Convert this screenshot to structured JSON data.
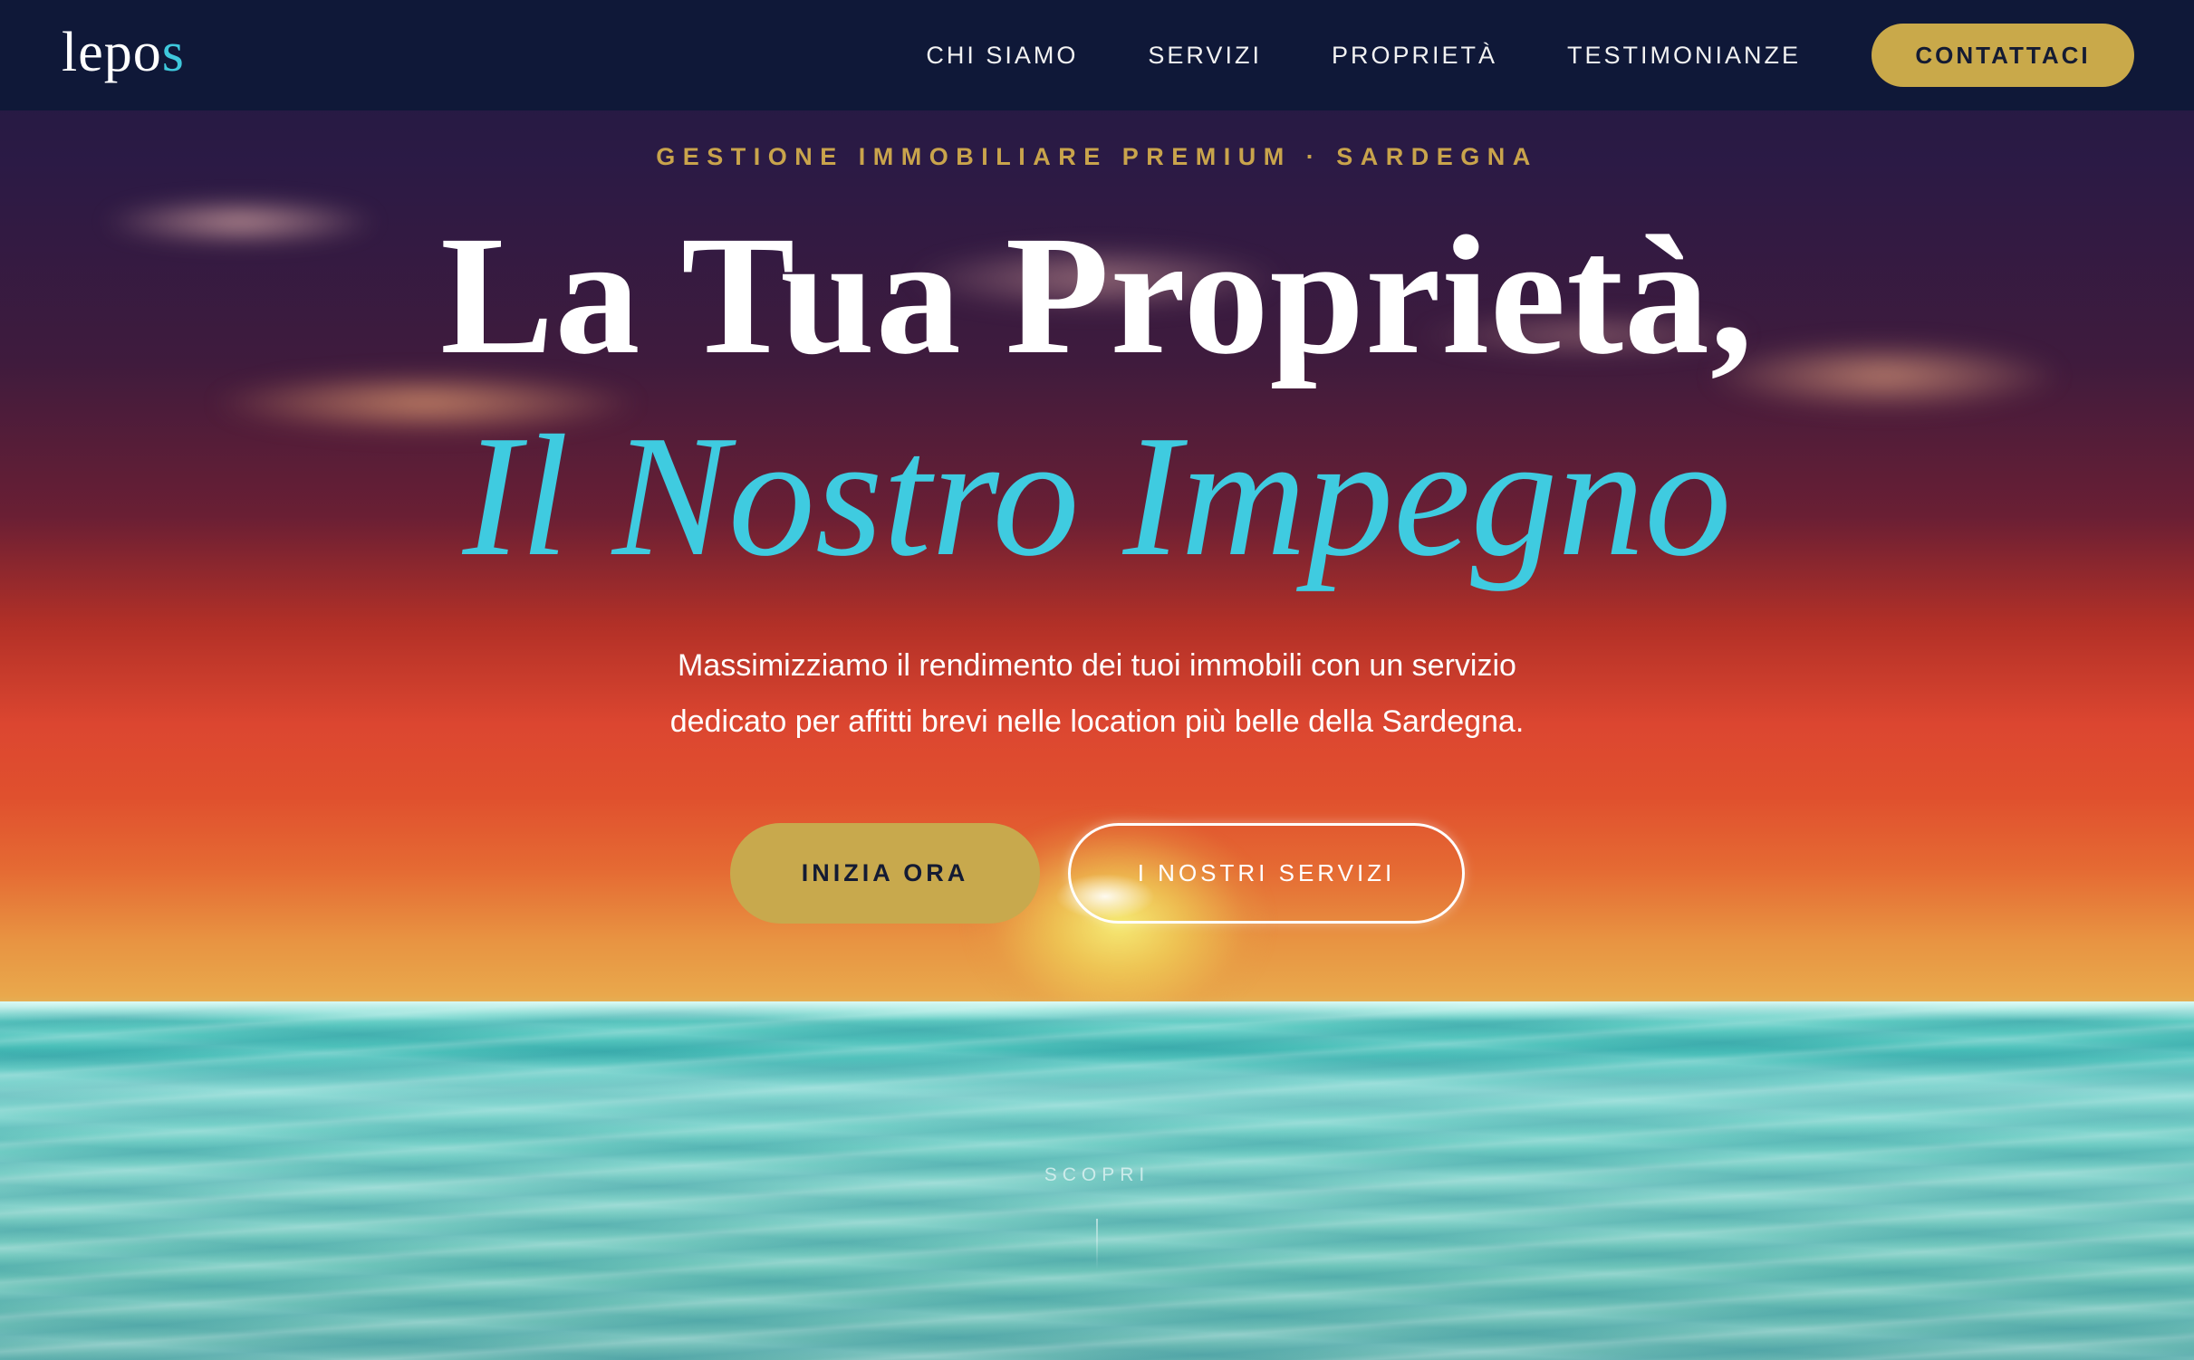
{
  "brand": {
    "logo_main": "lepo",
    "logo_accent": "s"
  },
  "nav": {
    "links": [
      "CHI SIAMO",
      "SERVIZI",
      "PROPRIETÀ",
      "TESTIMONIANZE"
    ],
    "cta": "CONTATTACI"
  },
  "hero": {
    "eyebrow": "GESTIONE IMMOBILIARE PREMIUM · SARDEGNA",
    "title_line1": "La Tua Proprietà,",
    "title_line2": "Il Nostro Impegno",
    "subtitle_line1": "Massimizziamo il rendimento dei tuoi immobili con un servizio",
    "subtitle_line2": "dedicato per affitti brevi nelle location più belle della Sardegna.",
    "primary_button": "INIZIA ORA",
    "secondary_button": "I NOSTRI SERVIZI",
    "scroll_hint": "SCOPRI"
  },
  "colors": {
    "navy": "#0f1838",
    "gold": "#c9a94a",
    "turquoise": "#3fcbe0"
  }
}
